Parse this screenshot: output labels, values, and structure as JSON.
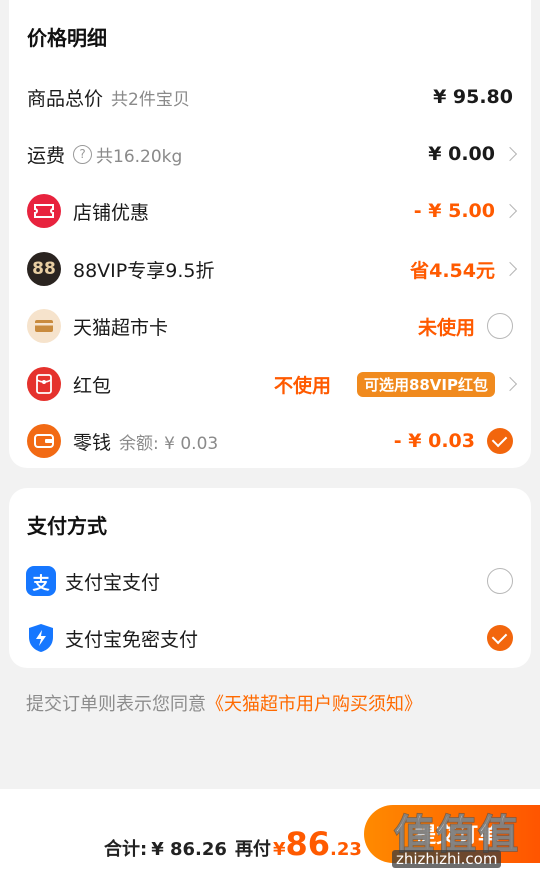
{
  "price_card": {
    "title": "价格明细",
    "total": {
      "label": "商品总价",
      "sub": "共2件宝贝",
      "value": "¥ 95.80"
    },
    "shipping": {
      "label": "运费",
      "sub": "共16.20kg",
      "value": "¥ 0.00"
    },
    "shop_discount": {
      "label": "店铺优惠",
      "value": "- ¥ 5.00"
    },
    "vip": {
      "label": "88VIP专享9.5折",
      "value": "省4.54元",
      "icon_text": "88"
    },
    "supermarket_card": {
      "label": "天猫超市卡",
      "value": "未使用"
    },
    "red_packet": {
      "label": "红包",
      "value": "不使用",
      "badge": "可选用88VIP红包"
    },
    "change": {
      "label": "零钱",
      "sub": "余额: ¥ 0.03",
      "value": "- ¥ 0.03"
    }
  },
  "pay_card": {
    "title": "支付方式",
    "methods": [
      {
        "label": "支付宝支付",
        "selected": false,
        "icon": "alipay-icon"
      },
      {
        "label": "支付宝免密支付",
        "selected": true,
        "icon": "shield-lightning-icon"
      }
    ]
  },
  "agreement": {
    "text": "提交订单则表示您同意",
    "link": "《天猫超市用户购买须知》"
  },
  "bottom": {
    "total_label": "合计:",
    "total_value": "¥ 86.26",
    "pay_label": "再付",
    "pay_currency": "¥",
    "pay_int": "86",
    "pay_dec": ".23",
    "submit": "提交订单"
  },
  "watermark": {
    "chars": "值值值",
    "url": "zhizhizhi.com"
  },
  "colors": {
    "accent": "#ff5a00",
    "check": "#f2660d",
    "badge": "#f08a1e"
  }
}
